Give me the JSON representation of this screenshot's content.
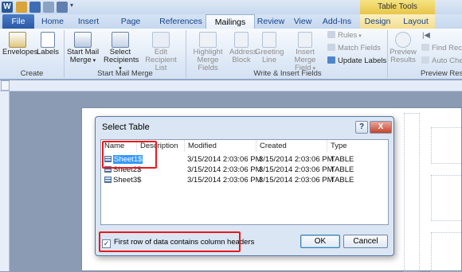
{
  "quick_access": {
    "app_icon": "word-icon"
  },
  "contextual": {
    "table_tools": "Table Tools"
  },
  "tabs": [
    "File",
    "Home",
    "Insert",
    "Page Layout",
    "References",
    "Mailings",
    "Review",
    "View",
    "Add-Ins",
    "Design",
    "Layout"
  ],
  "ribbon": {
    "create": {
      "label": "Create",
      "envelopes": "Envelopes",
      "labels": "Labels"
    },
    "start": {
      "label": "Start Mail Merge",
      "start_mail_merge": [
        "Start Mail",
        "Merge"
      ],
      "select_recipients": [
        "Select",
        "Recipients"
      ],
      "edit_recipient_list": [
        "Edit",
        "Recipient List"
      ]
    },
    "write": {
      "label": "Write & Insert Fields",
      "highlight": [
        "Highlight",
        "Merge Fields"
      ],
      "address_block": [
        "Address",
        "Block"
      ],
      "greeting_line": [
        "Greeting",
        "Line"
      ],
      "insert_merge_field": [
        "Insert Merge",
        "Field"
      ],
      "rules": "Rules",
      "match_fields": "Match Fields",
      "update_labels": "Update Labels"
    },
    "preview": {
      "label": "Preview Resu",
      "preview_results": [
        "Preview",
        "Results"
      ],
      "find_recipient": "Find Reci",
      "auto_check": "Auto Che"
    }
  },
  "dialog": {
    "title": "Select Table",
    "help": "?",
    "close": "X",
    "columns": [
      "Name",
      "Description",
      "Modified",
      "Created",
      "Type"
    ],
    "rows": [
      {
        "name": "Sheet1$",
        "description": "",
        "modified": "3/15/2014 2:03:06 PM",
        "created": "3/15/2014 2:03:06 PM",
        "type": "TABLE",
        "selected": true
      },
      {
        "name": "Sheet2$",
        "description": "",
        "modified": "3/15/2014 2:03:06 PM",
        "created": "3/15/2014 2:03:06 PM",
        "type": "TABLE",
        "selected": false
      },
      {
        "name": "Sheet3$",
        "description": "",
        "modified": "3/15/2014 2:03:06 PM",
        "created": "3/15/2014 2:03:06 PM",
        "type": "TABLE",
        "selected": false
      }
    ],
    "checkbox_label": "First row of data contains column headers",
    "checkbox_checked": true,
    "ok": "OK",
    "cancel": "Cancel"
  },
  "colors": {
    "highlight": "#e8191d",
    "selection": "#3399ff",
    "file_tab": "#2a5aa8"
  }
}
